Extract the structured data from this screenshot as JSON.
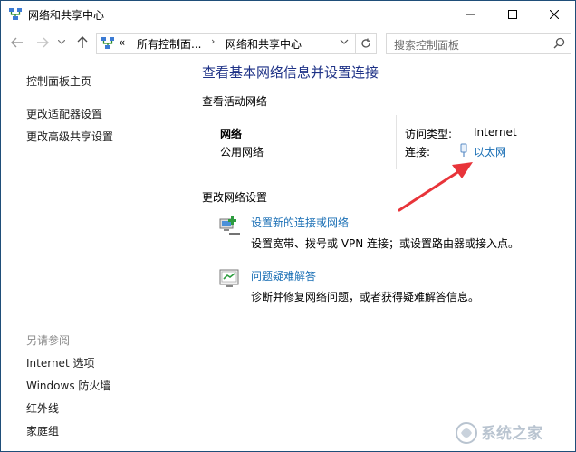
{
  "window": {
    "title": "网络和共享中心",
    "minimize_icon": "minimize-icon",
    "maximize_icon": "maximize-icon",
    "close_icon": "close-icon"
  },
  "nav": {
    "breadcrumb_overflow": "«",
    "crumbs": [
      "所有控制面...",
      "网络和共享中心"
    ],
    "search_placeholder": "搜索控制面板"
  },
  "sidebar": {
    "links": [
      "控制面板主页",
      "更改适配器设置",
      "更改高级共享设置"
    ],
    "see_also_heading": "另请参阅",
    "see_also": [
      "Internet 选项",
      "Windows 防火墙",
      "红外线",
      "家庭组"
    ]
  },
  "main": {
    "title": "查看基本网络信息并设置连接",
    "active_networks_heading": "查看活动网络",
    "network": {
      "name": "网络",
      "type": "公用网络",
      "access_type_label": "访问类型:",
      "access_type_value": "Internet",
      "connections_label": "连接:",
      "connection_name": "以太网"
    },
    "change_settings_heading": "更改网络设置",
    "tasks": [
      {
        "label": "设置新的连接或网络",
        "description": "设置宽带、拨号或 VPN 连接；或设置路由器或接入点。"
      },
      {
        "label": "问题疑难解答",
        "description": "诊断并修复网络问题，或者获得疑难解答信息。"
      }
    ]
  },
  "annotation_color": "#e8343a",
  "link_color": "#1a6fb5",
  "watermark": {
    "text": "系统之家"
  }
}
